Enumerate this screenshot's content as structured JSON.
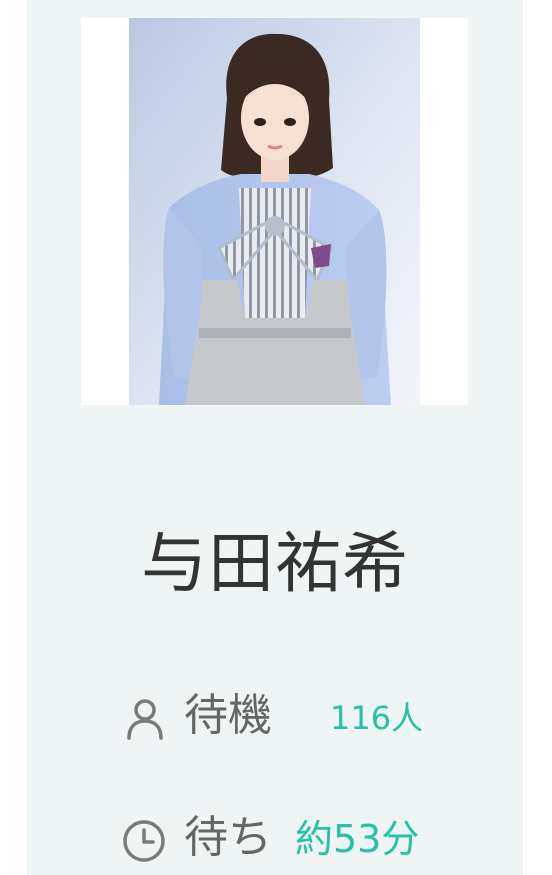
{
  "member": {
    "name": "与田祐希"
  },
  "queue": {
    "waiting_label": "待機",
    "waiting_count": "116人",
    "wait_time_label": "待ち",
    "wait_time_value": "約53分"
  },
  "colors": {
    "accent": "#26c2a8",
    "label": "#666666",
    "name": "#333333",
    "card_background": "#eff5f5"
  },
  "icons": {
    "waiting": "person-icon",
    "wait_time": "clock-icon"
  }
}
